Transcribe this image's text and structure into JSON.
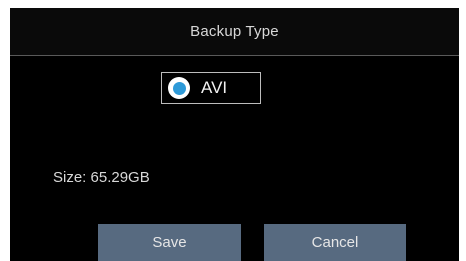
{
  "dialog": {
    "title": "Backup Type",
    "option": {
      "label": "AVI",
      "selected": true,
      "accent_color": "#2e9ad8"
    },
    "size_text": "Size: 65.29GB",
    "buttons": {
      "save_label": "Save",
      "cancel_label": "Cancel",
      "button_color": "#576a80"
    }
  }
}
